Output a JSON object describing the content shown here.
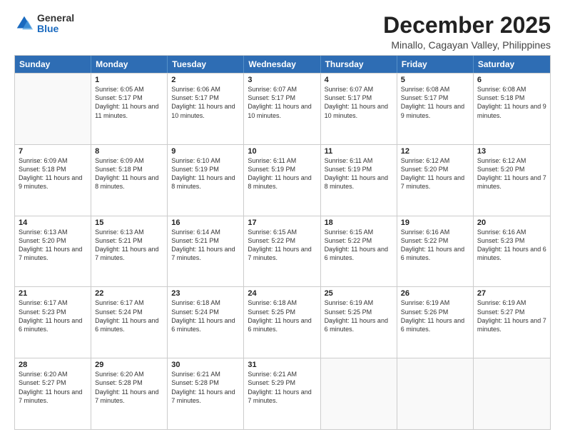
{
  "logo": {
    "general": "General",
    "blue": "Blue"
  },
  "title": "December 2025",
  "subtitle": "Minallo, Cagayan Valley, Philippines",
  "header": {
    "days": [
      "Sunday",
      "Monday",
      "Tuesday",
      "Wednesday",
      "Thursday",
      "Friday",
      "Saturday"
    ]
  },
  "weeks": [
    [
      {
        "day": "",
        "empty": true
      },
      {
        "day": "1",
        "sunrise": "6:05 AM",
        "sunset": "5:17 PM",
        "daylight": "11 hours and 11 minutes."
      },
      {
        "day": "2",
        "sunrise": "6:06 AM",
        "sunset": "5:17 PM",
        "daylight": "11 hours and 10 minutes."
      },
      {
        "day": "3",
        "sunrise": "6:07 AM",
        "sunset": "5:17 PM",
        "daylight": "11 hours and 10 minutes."
      },
      {
        "day": "4",
        "sunrise": "6:07 AM",
        "sunset": "5:17 PM",
        "daylight": "11 hours and 10 minutes."
      },
      {
        "day": "5",
        "sunrise": "6:08 AM",
        "sunset": "5:17 PM",
        "daylight": "11 hours and 9 minutes."
      },
      {
        "day": "6",
        "sunrise": "6:08 AM",
        "sunset": "5:18 PM",
        "daylight": "11 hours and 9 minutes."
      }
    ],
    [
      {
        "day": "7",
        "sunrise": "6:09 AM",
        "sunset": "5:18 PM",
        "daylight": "11 hours and 9 minutes."
      },
      {
        "day": "8",
        "sunrise": "6:09 AM",
        "sunset": "5:18 PM",
        "daylight": "11 hours and 8 minutes."
      },
      {
        "day": "9",
        "sunrise": "6:10 AM",
        "sunset": "5:19 PM",
        "daylight": "11 hours and 8 minutes."
      },
      {
        "day": "10",
        "sunrise": "6:11 AM",
        "sunset": "5:19 PM",
        "daylight": "11 hours and 8 minutes."
      },
      {
        "day": "11",
        "sunrise": "6:11 AM",
        "sunset": "5:19 PM",
        "daylight": "11 hours and 8 minutes."
      },
      {
        "day": "12",
        "sunrise": "6:12 AM",
        "sunset": "5:20 PM",
        "daylight": "11 hours and 7 minutes."
      },
      {
        "day": "13",
        "sunrise": "6:12 AM",
        "sunset": "5:20 PM",
        "daylight": "11 hours and 7 minutes."
      }
    ],
    [
      {
        "day": "14",
        "sunrise": "6:13 AM",
        "sunset": "5:20 PM",
        "daylight": "11 hours and 7 minutes."
      },
      {
        "day": "15",
        "sunrise": "6:13 AM",
        "sunset": "5:21 PM",
        "daylight": "11 hours and 7 minutes."
      },
      {
        "day": "16",
        "sunrise": "6:14 AM",
        "sunset": "5:21 PM",
        "daylight": "11 hours and 7 minutes."
      },
      {
        "day": "17",
        "sunrise": "6:15 AM",
        "sunset": "5:22 PM",
        "daylight": "11 hours and 7 minutes."
      },
      {
        "day": "18",
        "sunrise": "6:15 AM",
        "sunset": "5:22 PM",
        "daylight": "11 hours and 6 minutes."
      },
      {
        "day": "19",
        "sunrise": "6:16 AM",
        "sunset": "5:22 PM",
        "daylight": "11 hours and 6 minutes."
      },
      {
        "day": "20",
        "sunrise": "6:16 AM",
        "sunset": "5:23 PM",
        "daylight": "11 hours and 6 minutes."
      }
    ],
    [
      {
        "day": "21",
        "sunrise": "6:17 AM",
        "sunset": "5:23 PM",
        "daylight": "11 hours and 6 minutes."
      },
      {
        "day": "22",
        "sunrise": "6:17 AM",
        "sunset": "5:24 PM",
        "daylight": "11 hours and 6 minutes."
      },
      {
        "day": "23",
        "sunrise": "6:18 AM",
        "sunset": "5:24 PM",
        "daylight": "11 hours and 6 minutes."
      },
      {
        "day": "24",
        "sunrise": "6:18 AM",
        "sunset": "5:25 PM",
        "daylight": "11 hours and 6 minutes."
      },
      {
        "day": "25",
        "sunrise": "6:19 AM",
        "sunset": "5:25 PM",
        "daylight": "11 hours and 6 minutes."
      },
      {
        "day": "26",
        "sunrise": "6:19 AM",
        "sunset": "5:26 PM",
        "daylight": "11 hours and 6 minutes."
      },
      {
        "day": "27",
        "sunrise": "6:19 AM",
        "sunset": "5:27 PM",
        "daylight": "11 hours and 7 minutes."
      }
    ],
    [
      {
        "day": "28",
        "sunrise": "6:20 AM",
        "sunset": "5:27 PM",
        "daylight": "11 hours and 7 minutes."
      },
      {
        "day": "29",
        "sunrise": "6:20 AM",
        "sunset": "5:28 PM",
        "daylight": "11 hours and 7 minutes."
      },
      {
        "day": "30",
        "sunrise": "6:21 AM",
        "sunset": "5:28 PM",
        "daylight": "11 hours and 7 minutes."
      },
      {
        "day": "31",
        "sunrise": "6:21 AM",
        "sunset": "5:29 PM",
        "daylight": "11 hours and 7 minutes."
      },
      {
        "day": "",
        "empty": true
      },
      {
        "day": "",
        "empty": true
      },
      {
        "day": "",
        "empty": true
      }
    ]
  ]
}
